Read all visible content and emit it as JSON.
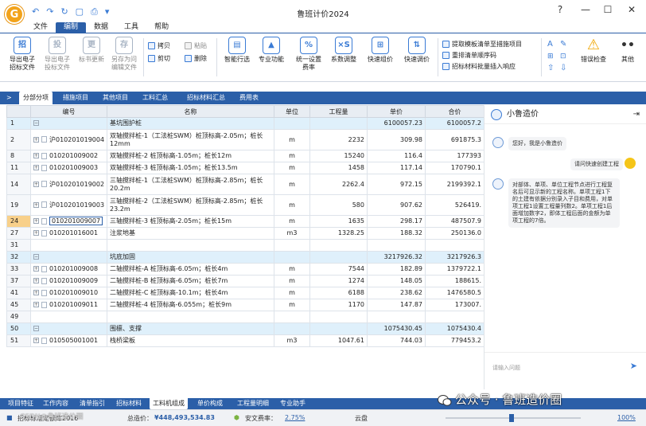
{
  "app": {
    "title": "鲁班计价2024",
    "logo": "G",
    "window_controls": [
      "?",
      "—",
      "☐",
      "✕"
    ]
  },
  "quick_access": [
    "↶",
    "↷",
    "↻",
    "▢",
    "⎙",
    "▾"
  ],
  "menu": [
    "文件",
    "编制",
    "数据",
    "工具",
    "帮助"
  ],
  "ribbon": {
    "export_bid": "导出电子\n招标文件",
    "export_tender": "导出电子\n投标文件",
    "standard_update": "标书更新",
    "save_as": "另存为问\n编辑文件",
    "copy": "拷贝",
    "cut": "剪切",
    "paste": "粘贴",
    "delete": "删除",
    "smart_select": "智能行选",
    "professional": "专业功能",
    "unify_fees": "统一设置\n费率",
    "coef_adjust": "系数调整",
    "quick_combine": "快速组价",
    "quick_adjust": "快速调价",
    "extract_template": "提取模板清单至措施项目",
    "renumber": "重排清单顺序码",
    "insert_material": "招标材料批量插入响应",
    "error_check": "错误检查",
    "more": "其他"
  },
  "sub_tabs": [
    "分部分项",
    "措施项目",
    "其他项目",
    "工料汇总",
    "招标材料汇总",
    "费用表"
  ],
  "table": {
    "headers": [
      "",
      "编号",
      "名称",
      "单位",
      "工程量",
      "单价",
      "合价"
    ],
    "rows": [
      {
        "rn": "1",
        "type": "group",
        "code": "",
        "name": "基坑围护桩",
        "unit": "",
        "qty": "",
        "price": "6100057.23",
        "total": "6100057.2"
      },
      {
        "rn": "2",
        "type": "item",
        "code": "沪010201019004",
        "name": "双轴搅拌桩-1（工法桩SWM）桩顶标高-2.05m；桩长12mm",
        "unit": "m",
        "qty": "2232",
        "price": "309.98",
        "total": "691875.3"
      },
      {
        "rn": "8",
        "type": "item",
        "code": "010201009002",
        "name": "双轴搅拌桩-2 桩顶标高-1.05m；桩长12m",
        "unit": "m",
        "qty": "15240",
        "price": "116.4",
        "total": "177393"
      },
      {
        "rn": "11",
        "type": "item",
        "code": "010201009003",
        "name": "双轴搅拌桩-3 桩顶标高-1.05m；桩长13.5m",
        "unit": "m",
        "qty": "1458",
        "price": "117.14",
        "total": "170790.1"
      },
      {
        "rn": "14",
        "type": "item",
        "code": "沪010201019002",
        "name": "三轴搅拌桩-1（工法桩SWM）桩顶标高-2.85m；桩长20.2m",
        "unit": "m",
        "qty": "2262.4",
        "price": "972.15",
        "total": "2199392.1"
      },
      {
        "rn": "19",
        "type": "item",
        "code": "沪010201019003",
        "name": "三轴搅拌桩-2（工法桩SWM）桩顶标高-2.85m；桩长23.2m",
        "unit": "m",
        "qty": "580",
        "price": "907.62",
        "total": "526419."
      },
      {
        "rn": "24",
        "type": "item",
        "code": "010201009007",
        "name": "三轴搅拌桩-3 桩顶标高-2.05m；桩长15m",
        "unit": "m",
        "qty": "1635",
        "price": "298.17",
        "total": "487507.9"
      },
      {
        "rn": "27",
        "type": "item",
        "code": "010201016001",
        "name": "注浆地基",
        "unit": "m3",
        "qty": "1328.25",
        "price": "188.32",
        "total": "250136.0"
      },
      {
        "rn": "31",
        "type": "blank",
        "code": "",
        "name": "",
        "unit": "",
        "qty": "",
        "price": "",
        "total": ""
      },
      {
        "rn": "32",
        "type": "group",
        "code": "",
        "name": "坑底加固",
        "unit": "",
        "qty": "",
        "price": "3217926.32",
        "total": "3217926.3"
      },
      {
        "rn": "33",
        "type": "item",
        "code": "010201009008",
        "name": "二轴搅拌桩-A 桩顶标高-6.05m；桩长4m",
        "unit": "m",
        "qty": "7544",
        "price": "182.89",
        "total": "1379722.1"
      },
      {
        "rn": "37",
        "type": "item",
        "code": "010201009009",
        "name": "二轴搅拌桩-B 桩顶标高-6.05m；桩长7m",
        "unit": "m",
        "qty": "1274",
        "price": "148.05",
        "total": "188615."
      },
      {
        "rn": "41",
        "type": "item",
        "code": "010201009010",
        "name": "二轴搅拌桩-C 桩顶标高-10.1m；桩长4m",
        "unit": "m",
        "qty": "6188",
        "price": "238.62",
        "total": "1476580.5"
      },
      {
        "rn": "45",
        "type": "item",
        "code": "010201009011",
        "name": "二轴搅拌桩-4 桩顶标高-6.055m；桩长9m",
        "unit": "m",
        "qty": "1170",
        "price": "147.87",
        "total": "173007."
      },
      {
        "rn": "49",
        "type": "blank",
        "code": "",
        "name": "",
        "unit": "",
        "qty": "",
        "price": "",
        "total": ""
      },
      {
        "rn": "50",
        "type": "group",
        "code": "",
        "name": "围檩、支撑",
        "unit": "",
        "qty": "",
        "price": "1075430.45",
        "total": "1075430.4"
      },
      {
        "rn": "51",
        "type": "item",
        "code": "010505001001",
        "name": "栈桥梁板",
        "unit": "m3",
        "qty": "1047.61",
        "price": "744.03",
        "total": "779453.2"
      }
    ]
  },
  "chat": {
    "title": "小鲁造价",
    "greeting": "您好，我是小鲁造价",
    "user_question": "请问快速创建工程",
    "answer": "对部体、单项、单位工程节点进行工程复名后可显示新的工程名称。单项工程1下的土建有依据分别录入子目和费用，对单项工程1设置工程量列数2。单项工程1后面增加数字2，即体工程后面的金额为单项工程的7倍。",
    "input_placeholder": "请输入问题"
  },
  "bottom_tabs": [
    "项目特征",
    "工作内容",
    "清单指引",
    "招标材料",
    "工料机组成",
    "单价构成",
    "工程量明细",
    "专业助手"
  ],
  "status": {
    "library": "招标标准定额库2016",
    "total_label": "总造价：",
    "total_value": "¥448,493,534.83",
    "safety_label": "安文费率：",
    "safety_value": "2.75%",
    "cloud": "云盘",
    "zoom": "100%"
  },
  "watermark": {
    "text": "公众号 · 鲁班造价圈",
    "left_text": "CSDN@鲁班造价圈"
  },
  "colors": {
    "accent": "#2b5fa8",
    "group_row": "#dff0fb",
    "active_row_num": "#f8d08a",
    "logo": "#f2a31b"
  }
}
